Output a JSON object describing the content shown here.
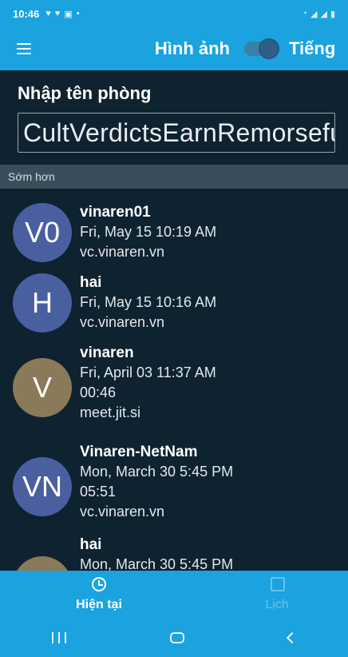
{
  "status_bar": {
    "time": "10:46"
  },
  "toolbar": {
    "video_label": "Hình ảnh",
    "audio_label": "Tiếng"
  },
  "room": {
    "label": "Nhập tên phòng",
    "value": "CultVerdictsEarnRemorsefully"
  },
  "section_header": "Sớm hơn",
  "recent_items": [
    {
      "initials": "V0",
      "name": "vinaren01",
      "date": "Fri, May 15 10:19 AM",
      "duration": "",
      "server": "vc.vinaren.vn",
      "avatar_color": "#4a5fa0"
    },
    {
      "initials": "H",
      "name": "hai",
      "date": "Fri, May 15 10:16 AM",
      "duration": "",
      "server": "vc.vinaren.vn",
      "avatar_color": "#4a5fa0"
    },
    {
      "initials": "V",
      "name": "vinaren",
      "date": "Fri, April 03 11:37 AM",
      "duration": "00:46",
      "server": "meet.jit.si",
      "avatar_color": "#8a7a5a"
    },
    {
      "initials": "VN",
      "name": "Vinaren-NetNam",
      "date": "Mon, March 30 5:45 PM",
      "duration": "05:51",
      "server": "vc.vinaren.vn",
      "avatar_color": "#4a5fa0"
    },
    {
      "initials": "H",
      "name": "hai",
      "date": "Mon, March 30 5:45 PM",
      "duration": "",
      "server": "",
      "avatar_color": "#8a7a5a"
    }
  ],
  "bottom_nav": {
    "current_label": "Hiện tại",
    "calendar_label": "Lịch"
  },
  "colors": {
    "accent": "#1aa3df",
    "background": "#0f2230",
    "section_header": "#3b4d5b"
  }
}
